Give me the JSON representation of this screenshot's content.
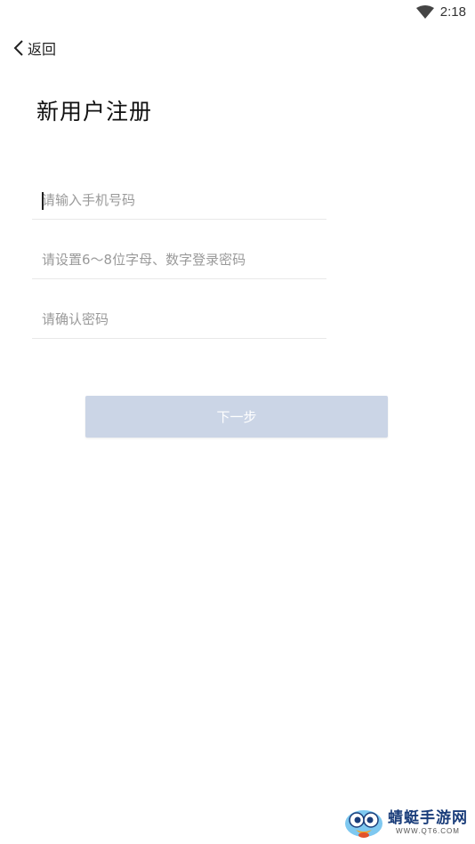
{
  "status_bar": {
    "time": "2:18",
    "wifi_icon": "wifi-icon"
  },
  "nav": {
    "back_label": "返回",
    "back_icon": "chevron-left-icon"
  },
  "page": {
    "title": "新用户注册"
  },
  "form": {
    "phone": {
      "placeholder": "请输入手机号码",
      "value": ""
    },
    "password": {
      "placeholder": "请设置6～8位字母、数字登录密码",
      "value": ""
    },
    "confirm": {
      "placeholder": "请确认密码",
      "value": ""
    }
  },
  "next_button": {
    "label": "下一步",
    "color": "#cbd5e6"
  },
  "watermark": {
    "name": "蜻蜓手游网",
    "url": "WWW.QT6.COM"
  }
}
